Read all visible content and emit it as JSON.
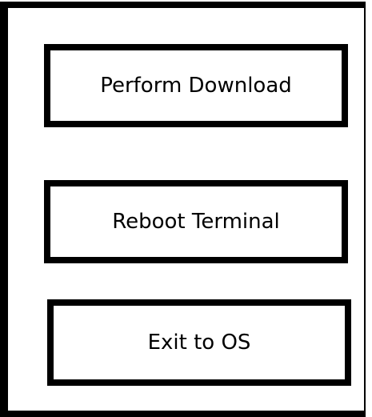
{
  "menu": {
    "items": [
      {
        "label": "Perform Download"
      },
      {
        "label": "Reboot Terminal"
      },
      {
        "label": "Exit to OS"
      }
    ]
  }
}
